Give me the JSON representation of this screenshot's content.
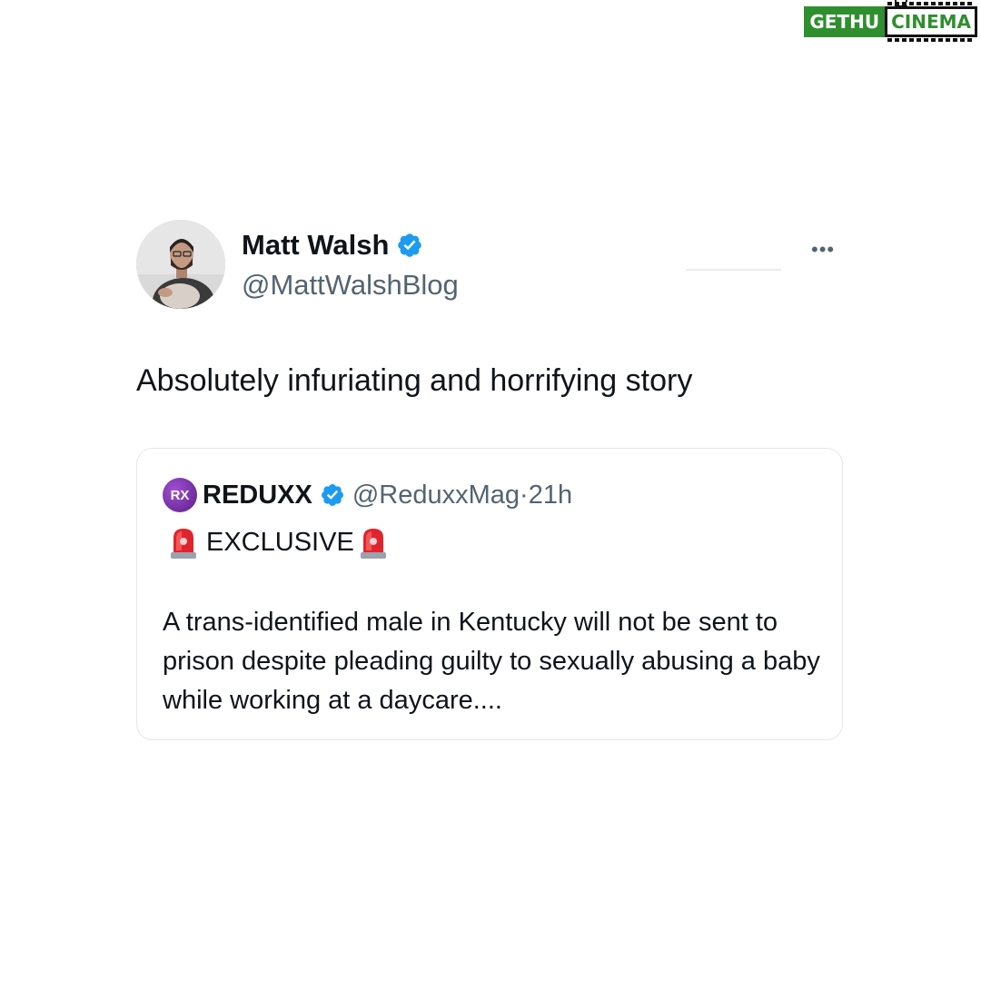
{
  "watermark": {
    "left_text": "GETHU",
    "right_text": "CINEMA"
  },
  "tweet": {
    "author_name": "Matt Walsh",
    "author_handle": "@MattWalshBlog",
    "verified_icon": "verified-badge-icon",
    "more_icon": "more-options-icon",
    "more_label": "•••",
    "text": "Absolutely infuriating and horrifying story"
  },
  "quoted_tweet": {
    "logo_text": "RX",
    "author_name": "REDUXX",
    "author_handle": "@ReduxxMag",
    "separator": "·",
    "time": "21h",
    "headline": "EXCLUSIVE",
    "siren_icon": "rotating-light-icon",
    "body": "A trans-identified male in Kentucky will not be sent to prison despite pleading guilty to sexually abusing a baby while working at a daycare...."
  },
  "colors": {
    "verified_blue": "#1d9bf0",
    "text_primary": "#0f1419",
    "text_secondary": "#536471",
    "watermark_green": "#2f8f2f",
    "card_border": "#e4e7ea"
  }
}
